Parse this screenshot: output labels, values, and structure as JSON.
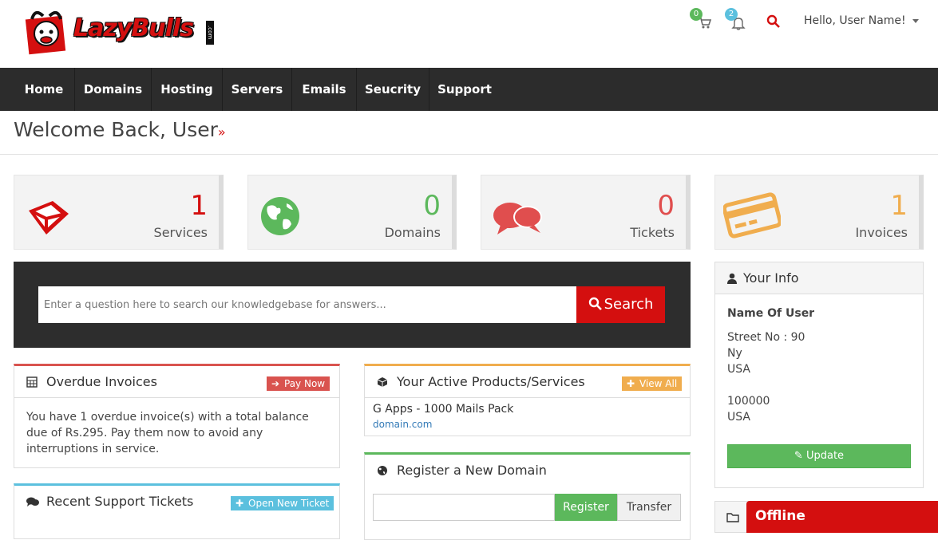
{
  "brand": {
    "name": "LazyBulls",
    "com": ".com"
  },
  "header": {
    "cart_count": "0",
    "notif_count": "2",
    "greeting": "Hello, User Name!"
  },
  "nav": [
    "Home",
    "Domains",
    "Hosting",
    "Servers",
    "Emails",
    "Seucrity",
    "Support"
  ],
  "welcome": {
    "title": "Welcome Back, User",
    "arrow": "»"
  },
  "stats": [
    {
      "value": "1",
      "label": "Services",
      "color": "#d40f0f",
      "icon": "box-icon"
    },
    {
      "value": "0",
      "label": "Domains",
      "color": "#5cb85c",
      "icon": "globe-icon"
    },
    {
      "value": "0",
      "label": "Tickets",
      "color": "#e04e4e",
      "icon": "chat-icon"
    },
    {
      "value": "1",
      "label": "Invoices",
      "color": "#f0ad4e",
      "icon": "credit-card-icon"
    }
  ],
  "kb": {
    "placeholder": "Enter a question here to search our knowledgebase for answers...",
    "button": "Search"
  },
  "overdue": {
    "title": "Overdue Invoices",
    "button": "Pay Now",
    "text": "You have 1 overdue invoice(s) with a total balance due of Rs.295. Pay them now to avoid any interruptions in service."
  },
  "tickets": {
    "title": "Recent Support Tickets",
    "button": "Open New Ticket"
  },
  "products": {
    "title": "Your Active Products/Services",
    "button": "View All",
    "item_name": "G Apps - 1000 Mails Pack",
    "item_domain": "domain.com"
  },
  "register": {
    "title": "Register a New Domain",
    "register": "Register",
    "transfer": "Transfer"
  },
  "info": {
    "title": "Your Info",
    "name": "Name Of User",
    "street": "Street No : 90",
    "city": "Ny",
    "country1": "USA",
    "zip": "100000",
    "country2": "USA",
    "button": "Update"
  },
  "chat": {
    "status": "Offline"
  },
  "colors": {
    "red": "#d40f0f",
    "green": "#5cb85c",
    "blue": "#5bc0de",
    "orange": "#f0ad4e",
    "nav": "#2c2c2c"
  }
}
